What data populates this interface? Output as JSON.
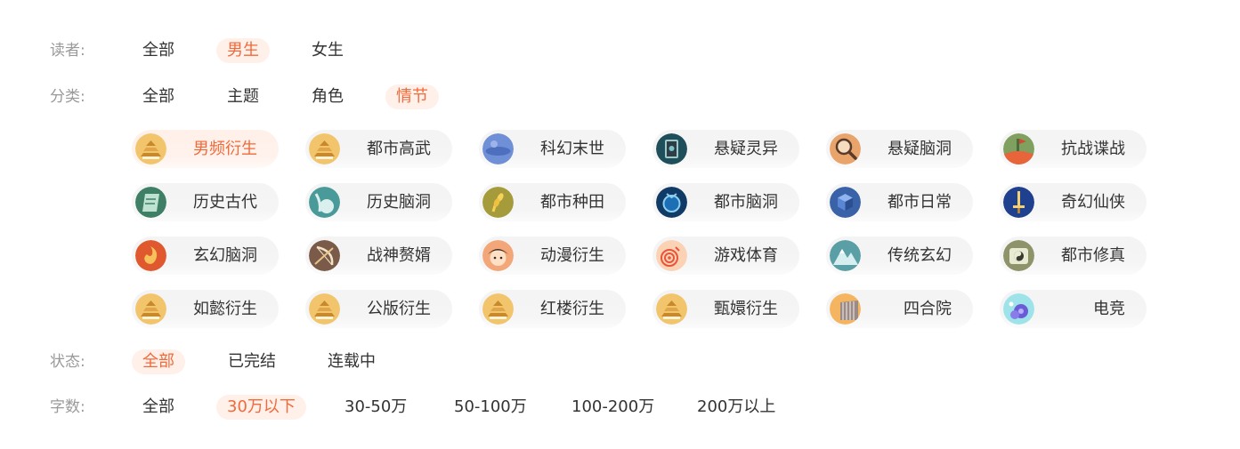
{
  "reader": {
    "label": "读者:",
    "options": [
      "全部",
      "男生",
      "女生"
    ],
    "selected": "男生"
  },
  "category": {
    "label": "分类:",
    "options": [
      "全部",
      "主题",
      "角色",
      "情节"
    ],
    "selected": "情节"
  },
  "plot_tags": {
    "selected": "男频衍生",
    "items": [
      {
        "name": "男频衍生",
        "icon": "golden-pagoda-icon"
      },
      {
        "name": "都市高武",
        "icon": "golden-pagoda-icon"
      },
      {
        "name": "科幻末世",
        "icon": "blue-planet-icon"
      },
      {
        "name": "悬疑灵异",
        "icon": "dark-shrine-icon"
      },
      {
        "name": "悬疑脑洞",
        "icon": "magnifier-icon"
      },
      {
        "name": "抗战谍战",
        "icon": "battlefield-icon"
      },
      {
        "name": "历史古代",
        "icon": "scroll-icon"
      },
      {
        "name": "历史脑洞",
        "icon": "teal-figure-icon"
      },
      {
        "name": "都市种田",
        "icon": "wheat-icon"
      },
      {
        "name": "都市脑洞",
        "icon": "navy-orb-icon"
      },
      {
        "name": "都市日常",
        "icon": "blue-cube-icon"
      },
      {
        "name": "奇幻仙侠",
        "icon": "sword-icon"
      },
      {
        "name": "玄幻脑洞",
        "icon": "flame-swirl-icon"
      },
      {
        "name": "战神赘婿",
        "icon": "bow-icon"
      },
      {
        "name": "动漫衍生",
        "icon": "anime-face-icon"
      },
      {
        "name": "游戏体育",
        "icon": "target-icon"
      },
      {
        "name": "传统玄幻",
        "icon": "mountain-icon"
      },
      {
        "name": "都市修真",
        "icon": "taiji-icon"
      },
      {
        "name": "如懿衍生",
        "icon": "golden-pagoda-icon"
      },
      {
        "name": "公版衍生",
        "icon": "golden-pagoda-icon"
      },
      {
        "name": "红楼衍生",
        "icon": "golden-pagoda-icon"
      },
      {
        "name": "甄嬛衍生",
        "icon": "golden-pagoda-icon"
      },
      {
        "name": "四合院",
        "icon": "courtyard-icon"
      },
      {
        "name": "电竞",
        "icon": "gamepad-icon"
      }
    ]
  },
  "status": {
    "label": "状态:",
    "options": [
      "全部",
      "已完结",
      "连载中"
    ],
    "selected": "全部"
  },
  "word_count": {
    "label": "字数:",
    "options": [
      "全部",
      "30万以下",
      "30-50万",
      "50-100万",
      "100-200万",
      "200万以上"
    ],
    "selected": "30万以下"
  },
  "colors": {
    "accent": "#f06a3a",
    "accent_bg": "#fff0ea",
    "label_gray": "#9a9a9a",
    "tag_bg": "#f5f5f5"
  }
}
